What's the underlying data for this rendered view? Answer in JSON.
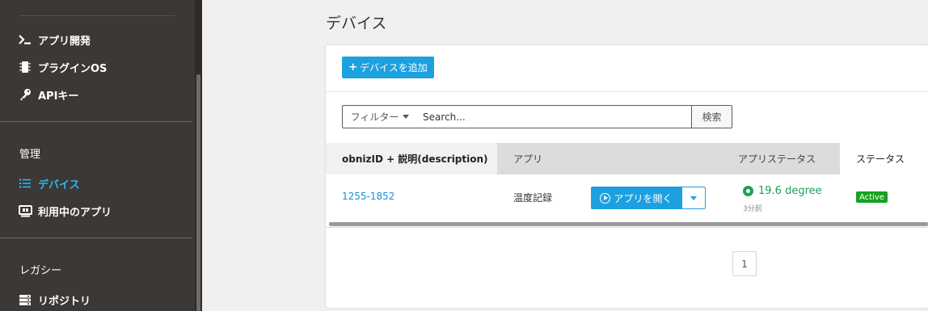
{
  "sidebar": {
    "items": [
      {
        "label": "アプリ開発",
        "icon": "terminal-icon"
      },
      {
        "label": "プラグインOS",
        "icon": "chip-icon"
      },
      {
        "label": "APIキー",
        "icon": "key-icon"
      }
    ],
    "sections": [
      {
        "heading": "管理",
        "items": [
          {
            "label": "デバイス",
            "icon": "list-icon",
            "active": true
          },
          {
            "label": "利用中のアプリ",
            "icon": "monitor-icon"
          }
        ]
      },
      {
        "heading": "レガシー",
        "items": [
          {
            "label": "リポジトリ",
            "icon": "server-icon"
          }
        ]
      }
    ]
  },
  "main": {
    "title": "デバイス",
    "add_button": "デバイスを追加",
    "filter_label": "フィルター",
    "search_placeholder": "Search...",
    "search_button": "検索",
    "table": {
      "headers": [
        "obnizID + 説明(description)",
        "アプリ",
        "アプリステータス",
        "ステータス"
      ],
      "rows": [
        {
          "id": "1255-1852",
          "app": "温度記録",
          "open_button": "アプリを開く",
          "app_status": "19.6 degree",
          "app_status_time": "3分前",
          "status": "Active"
        }
      ]
    },
    "pagination": {
      "current": "1"
    }
  },
  "colors": {
    "accent": "#1ca0e0",
    "sidebar_bg": "#3b3836",
    "active_item": "#2db7f5",
    "status_green": "#19a35a",
    "badge_green": "#15a31d"
  }
}
